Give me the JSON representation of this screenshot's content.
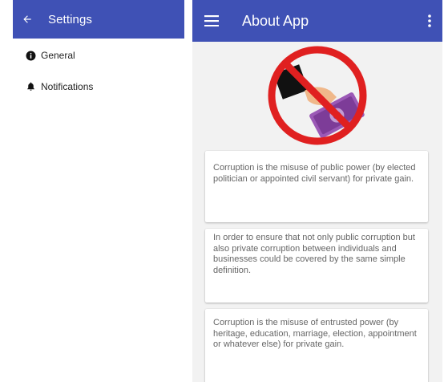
{
  "settings": {
    "title": "Settings",
    "items": [
      {
        "label": "General",
        "icon": "info-icon"
      },
      {
        "label": "Notifications",
        "icon": "bell-icon"
      }
    ]
  },
  "about": {
    "title": "About App",
    "hero_icon": "no-bribery-icon",
    "cards": [
      {
        "text": "Corruption is the misuse of public power (by elected politician or appointed civil servant) for private gain."
      },
      {
        "text": "In order to ensure that not only public corruption but also private corruption between individuals and businesses could be covered by the same simple definition."
      },
      {
        "text": "Corruption is the misuse of entrusted power (by heritage, education, marriage, election, appointment or whatever else) for private gain."
      }
    ]
  },
  "colors": {
    "primary": "#3f51b5",
    "background": "#f2f2f2",
    "card_text": "#666666",
    "forbidden_red": "#e02020",
    "money_purple": "#8e44ad"
  }
}
